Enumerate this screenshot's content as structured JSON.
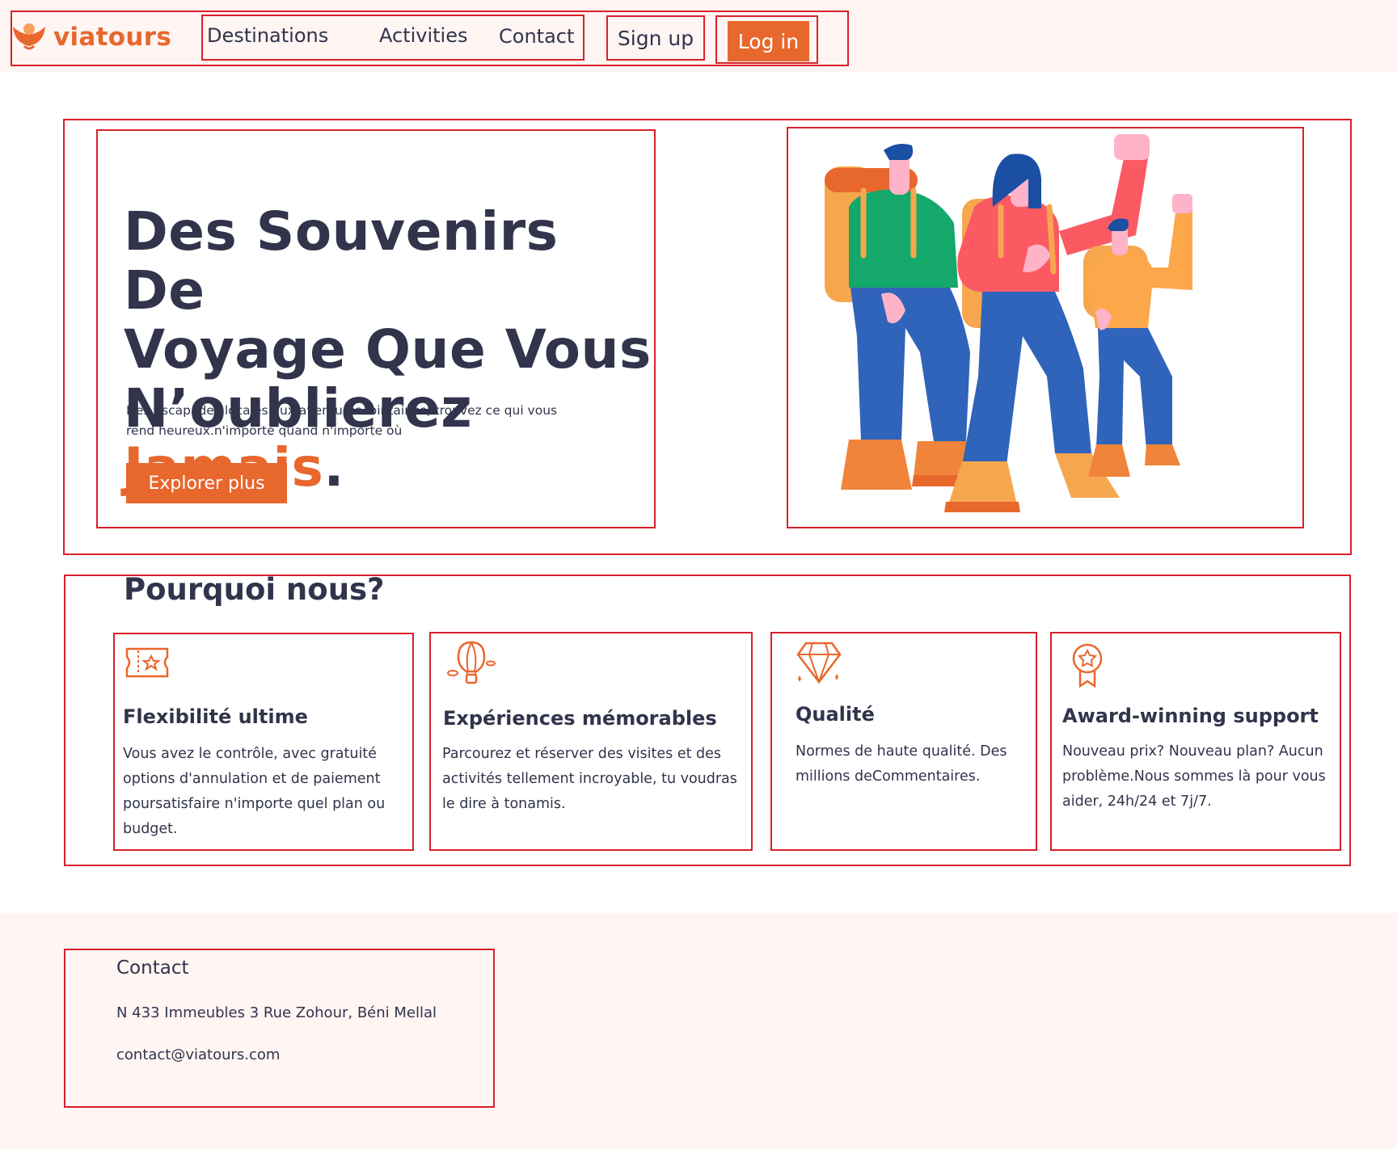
{
  "brand": {
    "name": "viatours",
    "accent_color": "#e8672d",
    "text_color": "#31344b",
    "tint_color": "#fff5f3"
  },
  "nav": {
    "links": [
      "Destinations",
      "Activities",
      "Contact"
    ],
    "signup_label": "Sign up",
    "login_label": "Log in"
  },
  "hero": {
    "title_line1": "Des Souvenirs De",
    "title_line2": "Voyage Que Vous",
    "title_line3_main": "N’oublierez ",
    "title_line3_accent": "Jamais",
    "title_line3_end": ".",
    "subtitle_line1": "Des escapades locales aux aventures lointaines, trouvez ce qui vous",
    "subtitle_line2": "rend heureux.n'importe quand n'importe où",
    "cta_label": "Explorer plus",
    "illustration": "travelers-with-backpacks-illustration"
  },
  "why": {
    "title": "Pourquoi nous?",
    "cards": [
      {
        "icon": "ticket-icon",
        "title": "Flexibilité ultime",
        "lines": [
          "Vous avez le contrôle, avec gratuité",
          "options d'annulation et de paiement",
          "poursatisfaire n'importe quel plan ou",
          "budget."
        ]
      },
      {
        "icon": "hot-air-balloon-icon",
        "title": "Expériences mémorables",
        "lines": [
          "Parcourez et réserver des visites et des",
          "activités tellement incroyable, tu voudras",
          "le dire à tonamis."
        ]
      },
      {
        "icon": "diamond-icon",
        "title": "Qualité",
        "lines": [
          "Normes de haute qualité. Des",
          "millions deCommentaires."
        ]
      },
      {
        "icon": "award-medal-icon",
        "title": "Award-winning support",
        "lines": [
          "Nouveau prix? Nouveau plan? Aucun",
          "problème.Nous sommes là pour vous",
          "aider, 24h/24 et 7j/7."
        ]
      }
    ]
  },
  "footer": {
    "contact_title": "Contact",
    "address": "N 433 Immeubles 3 Rue Zohour, Béni Mellal",
    "email": "contact@viatours.com"
  }
}
